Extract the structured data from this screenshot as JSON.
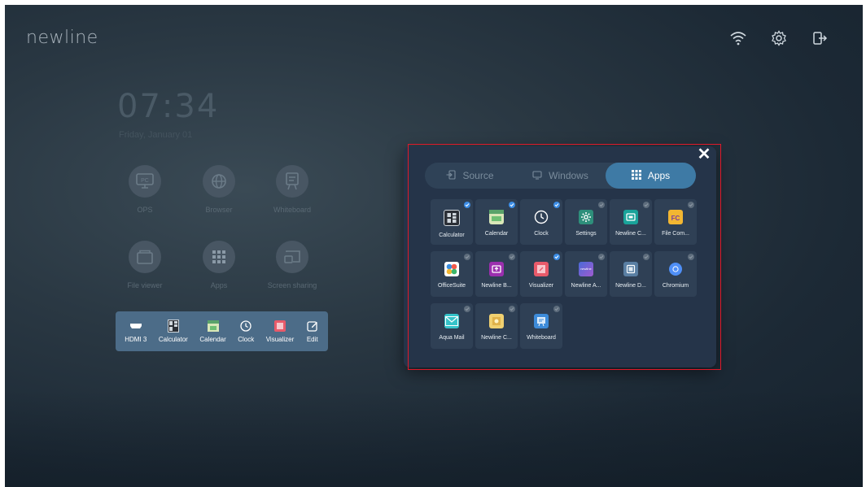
{
  "brand": "newline",
  "top_icons": [
    "wifi-icon",
    "gear-icon",
    "exit-icon"
  ],
  "home": {
    "time": "07:34",
    "date": "Friday, January 01",
    "tiles": [
      {
        "label": "OPS",
        "icon": "pc-icon",
        "glyph": "PC"
      },
      {
        "label": "Browser",
        "icon": "globe-icon",
        "glyph": "◉"
      },
      {
        "label": "Whiteboard",
        "icon": "whiteboard-icon",
        "glyph": "✎"
      },
      {
        "label": "File viewer",
        "icon": "folder-icon",
        "glyph": "▭"
      },
      {
        "label": "Apps",
        "icon": "apps-grid-icon",
        "glyph": "⋮⋮⋮"
      },
      {
        "label": "Screen sharing",
        "icon": "cast-icon",
        "glyph": "⧉"
      }
    ]
  },
  "dock": [
    {
      "label": "HDMI 3",
      "icon": "hdmi-icon"
    },
    {
      "label": "Calculator",
      "icon": "calculator-icon"
    },
    {
      "label": "Calendar",
      "icon": "calendar-icon"
    },
    {
      "label": "Clock",
      "icon": "clock-icon"
    },
    {
      "label": "Visualizer",
      "icon": "visualizer-icon"
    },
    {
      "label": "Edit",
      "icon": "edit-icon"
    }
  ],
  "panel": {
    "close_label": "✕",
    "tabs": [
      {
        "label": "Source",
        "icon": "source-icon"
      },
      {
        "label": "Windows",
        "icon": "monitor-icon"
      },
      {
        "label": "Apps",
        "icon": "apps-icon",
        "active": true
      }
    ],
    "apps": [
      {
        "name": "Calculator",
        "icon": "calculator-icon",
        "color": "#2b2f36",
        "checked": true
      },
      {
        "name": "Calendar",
        "icon": "calendar-icon",
        "color": "#6fbf73",
        "checked": true
      },
      {
        "name": "Clock",
        "icon": "clock-icon",
        "color": "#2f4055",
        "checked": true
      },
      {
        "name": "Settings",
        "icon": "settings-icon",
        "color": "#2e8f7b",
        "checked": false
      },
      {
        "name": "Newline C...",
        "icon": "newline-cast-icon",
        "color": "#19a39a",
        "checked": false
      },
      {
        "name": "File Com...",
        "icon": "file-commander-icon",
        "color": "#f2b632",
        "checked": false
      },
      {
        "name": "OfficeSuite",
        "icon": "officesuite-icon",
        "color": "#ffffff",
        "checked": false
      },
      {
        "name": "Newline B...",
        "icon": "newline-broadcast-icon",
        "color": "#9b2fae",
        "checked": false
      },
      {
        "name": "Visualizer",
        "icon": "visualizer-icon",
        "color": "#e85a6a",
        "checked": true
      },
      {
        "name": "Newline A...",
        "icon": "newline-assistant-icon",
        "color": "#6a5bd0",
        "checked": false
      },
      {
        "name": "Newline D...",
        "icon": "newline-display-icon",
        "color": "#5a7fa3",
        "checked": false
      },
      {
        "name": "Chromium",
        "icon": "chromium-icon",
        "color": "#4f8ff7",
        "checked": false
      },
      {
        "name": "Aqua Mail",
        "icon": "aqua-mail-icon",
        "color": "#35c3c9",
        "checked": false
      },
      {
        "name": "Newline C...",
        "icon": "newline-capture-icon",
        "color": "#e0b24a",
        "checked": false
      },
      {
        "name": "Whiteboard",
        "icon": "whiteboard-icon",
        "color": "#3d8bd9",
        "checked": false
      }
    ]
  }
}
